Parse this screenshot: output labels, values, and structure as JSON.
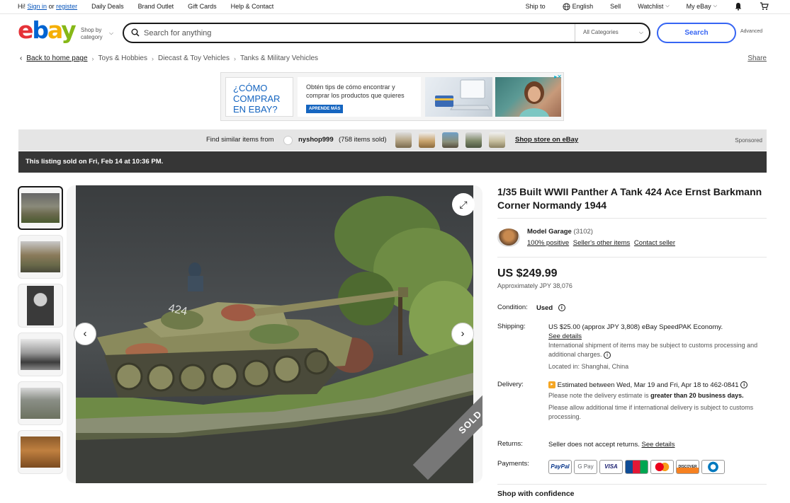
{
  "topbar": {
    "greeting": "Hi!",
    "sign_in": "Sign in",
    "or": "or",
    "register": "register",
    "links": [
      "Daily Deals",
      "Brand Outlet",
      "Gift Cards",
      "Help & Contact"
    ],
    "ship_to": "Ship to",
    "language": "English",
    "sell": "Sell",
    "watchlist": "Watchlist",
    "my_ebay": "My eBay"
  },
  "header": {
    "logo": [
      "e",
      "b",
      "a",
      "y"
    ],
    "shop_by": "Shop by",
    "category": "category",
    "search_placeholder": "Search for anything",
    "category_select": "All Categories",
    "search_button": "Search",
    "advanced": "Advanced"
  },
  "breadcrumb": {
    "back": "Back to home page",
    "items": [
      "Toys & Hobbies",
      "Diecast & Toy Vehicles",
      "Tanks & Military Vehicles"
    ],
    "share": "Share"
  },
  "ad": {
    "headline": "¿CÓMO COMPRAR EN EBAY?",
    "text": "Obtén tips de cómo encontrar y comprar los productos que quieres",
    "cta": "APRENDE MÁS"
  },
  "similar": {
    "label": "Find similar items from",
    "seller": "nyshop999",
    "sold": "(758 items sold)",
    "store_link": "Shop store on eBay",
    "sponsored": "Sponsored"
  },
  "sold_notice": "This listing sold on Fri, Feb 14 at 10:36 PM.",
  "gallery": {
    "sold_ribbon": "SOLD"
  },
  "listing": {
    "title": "1/35 Built WWII Panther A Tank 424 Ace Ernst Barkmann Corner Normandy 1944",
    "seller_name": "Model Garage",
    "seller_feedback": "(3102)",
    "seller_positive": "100% positive",
    "seller_other_items": "Seller's other items",
    "contact_seller": "Contact seller",
    "price": "US $249.99",
    "approx": "Approximately JPY 38,076",
    "condition_label": "Condition:",
    "condition_value": "Used",
    "shipping_label": "Shipping:",
    "shipping_value": "US $25.00 (approx JPY 3,808) eBay SpeedPAK Economy.",
    "see_details": "See details",
    "shipping_note": "International shipment of items may be subject to customs processing and additional charges.",
    "located": "Located in: Shanghai, China",
    "delivery_label": "Delivery:",
    "delivery_value": "Estimated between Wed, Mar 19 and Fri, Apr 18 to 462-0841",
    "delivery_note_pre": "Please note the delivery estimate is",
    "delivery_note_bold": "greater than 20 business days.",
    "delivery_note2": "Please allow additional time if international delivery is subject to customs processing.",
    "returns_label": "Returns:",
    "returns_value": "Seller does not accept returns.",
    "returns_link": "See details",
    "payments_label": "Payments:",
    "payment_methods": [
      "PayPal",
      "G Pay",
      "VISA",
      "JCB",
      "",
      "DISCOVER",
      ""
    ],
    "shop_confidence": "Shop with confidence"
  }
}
